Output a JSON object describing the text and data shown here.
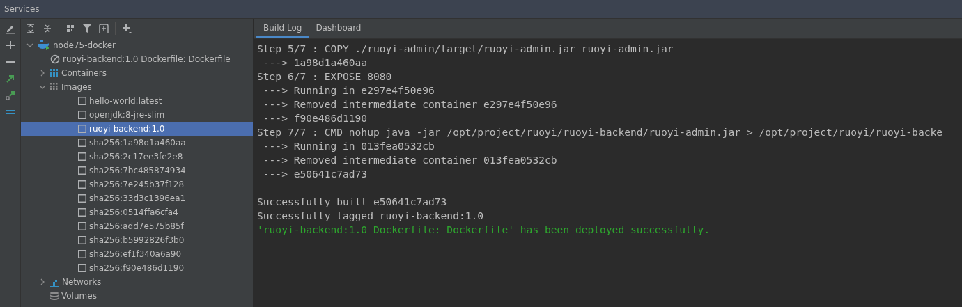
{
  "window": {
    "title": "Services"
  },
  "tree": [
    {
      "label": "node75-docker",
      "kind": "docker",
      "expanded": true,
      "selected": false,
      "children": [
        {
          "label": "ruoyi-backend:1.0 Dockerfile: Dockerfile",
          "kind": "deployment",
          "selected": false
        },
        {
          "label": "Containers",
          "kind": "containers",
          "expanded": false,
          "selected": false
        },
        {
          "label": "Images",
          "kind": "images",
          "expanded": true,
          "selected": false,
          "children": [
            {
              "label": "hello-world:latest",
              "kind": "image",
              "selected": false
            },
            {
              "label": "openjdk:8-jre-slim",
              "kind": "image",
              "selected": false
            },
            {
              "label": "ruoyi-backend:1.0",
              "kind": "image",
              "selected": true
            },
            {
              "label": "sha256:1a98d1a460aa",
              "kind": "image",
              "selected": false
            },
            {
              "label": "sha256:2c17ee3fe2e8",
              "kind": "image",
              "selected": false
            },
            {
              "label": "sha256:7bc485874934",
              "kind": "image",
              "selected": false
            },
            {
              "label": "sha256:7e245b37f128",
              "kind": "image",
              "selected": false
            },
            {
              "label": "sha256:33d3c1396ea1",
              "kind": "image",
              "selected": false
            },
            {
              "label": "sha256:0514ffa6cfa4",
              "kind": "image",
              "selected": false
            },
            {
              "label": "sha256:add7e575b85f",
              "kind": "image",
              "selected": false
            },
            {
              "label": "sha256:b5992826f3b0",
              "kind": "image",
              "selected": false
            },
            {
              "label": "sha256:ef1f340a6a90",
              "kind": "image",
              "selected": false
            },
            {
              "label": "sha256:f90e486d1190",
              "kind": "image",
              "selected": false
            }
          ]
        },
        {
          "label": "Networks",
          "kind": "networks",
          "expanded": false,
          "selected": false
        },
        {
          "label": "Volumes",
          "kind": "volumes",
          "selected": false
        }
      ]
    }
  ],
  "tabs": [
    {
      "label": "Build Log",
      "selected": true
    },
    {
      "label": "Dashboard",
      "selected": false
    }
  ],
  "log": [
    {
      "text": "Step 5/7 : COPY ./ruoyi-admin/target/ruoyi-admin.jar ruoyi-admin.jar",
      "kind": "normal"
    },
    {
      "text": " ---> 1a98d1a460aa",
      "kind": "normal"
    },
    {
      "text": "Step 6/7 : EXPOSE 8080",
      "kind": "normal"
    },
    {
      "text": " ---> Running in e297e4f50e96",
      "kind": "normal"
    },
    {
      "text": " ---> Removed intermediate container e297e4f50e96",
      "kind": "normal"
    },
    {
      "text": " ---> f90e486d1190",
      "kind": "normal"
    },
    {
      "text": "Step 7/7 : CMD nohup java -jar /opt/project/ruoyi/ruoyi-backend/ruoyi-admin.jar > /opt/project/ruoyi/ruoyi-backe",
      "kind": "normal"
    },
    {
      "text": " ---> Running in 013fea0532cb",
      "kind": "normal"
    },
    {
      "text": " ---> Removed intermediate container 013fea0532cb",
      "kind": "normal"
    },
    {
      "text": " ---> e50641c7ad73",
      "kind": "normal"
    },
    {
      "kind": "blank"
    },
    {
      "text": "Successfully built e50641c7ad73",
      "kind": "normal"
    },
    {
      "text": "Successfully tagged ruoyi-backend:1.0",
      "kind": "normal"
    },
    {
      "text": "'ruoyi-backend:1.0 Dockerfile: Dockerfile' has been deployed successfully.",
      "kind": "success"
    }
  ]
}
